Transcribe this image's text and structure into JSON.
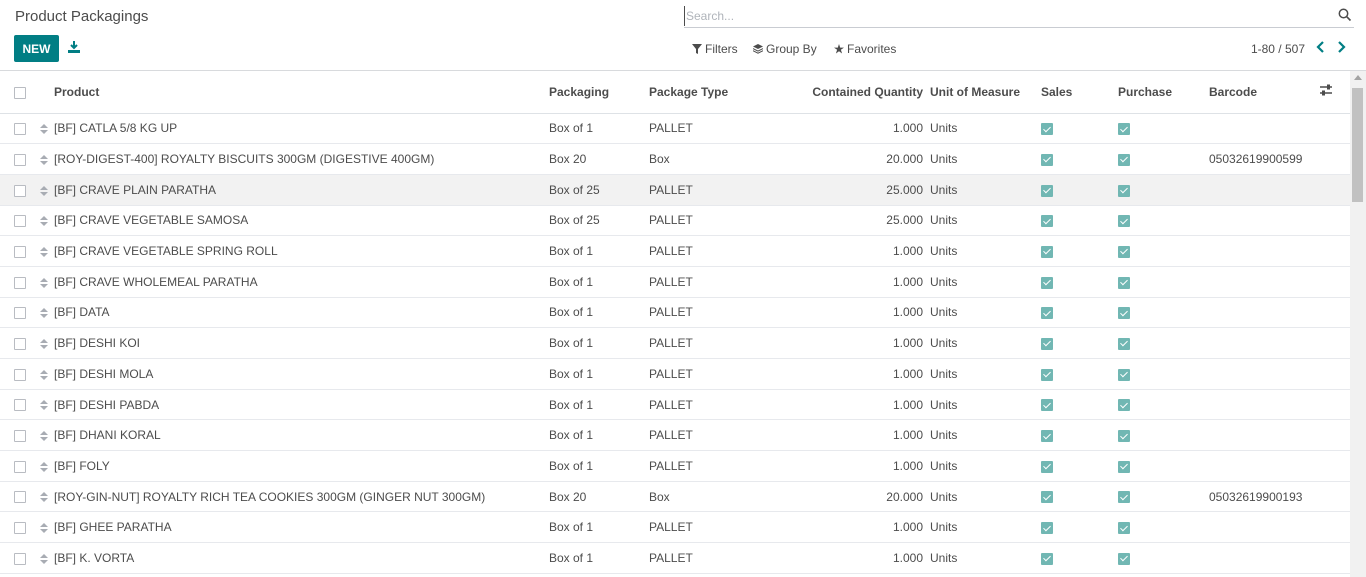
{
  "page": {
    "title": "Product Packagings",
    "new_label": "NEW",
    "search_placeholder": "Search...",
    "filters_label": "Filters",
    "groupby_label": "Group By",
    "favorites_label": "Favorites",
    "pager_text": "1-80 / 507"
  },
  "table": {
    "headers": {
      "product": "Product",
      "packaging": "Packaging",
      "package_type": "Package Type",
      "contained_quantity": "Contained Quantity",
      "uom": "Unit of Measure",
      "sales": "Sales",
      "purchase": "Purchase",
      "barcode": "Barcode"
    },
    "rows": [
      {
        "product": "[BF] CATLA 5/8 KG UP",
        "packaging": "Box of 1",
        "package_type": "PALLET",
        "qty": "1.000",
        "uom": "Units",
        "sales": true,
        "purchase": true,
        "barcode": ""
      },
      {
        "product": "[ROY-DIGEST-400] ROYALTY BISCUITS 300GM (DIGESTIVE 400GM)",
        "packaging": "Box 20",
        "package_type": "Box",
        "qty": "20.000",
        "uom": "Units",
        "sales": true,
        "purchase": true,
        "barcode": "05032619900599"
      },
      {
        "product": "[BF] CRAVE PLAIN PARATHA",
        "packaging": "Box of 25",
        "package_type": "PALLET",
        "qty": "25.000",
        "uom": "Units",
        "sales": true,
        "purchase": true,
        "barcode": ""
      },
      {
        "product": "[BF] CRAVE VEGETABLE SAMOSA",
        "packaging": "Box of 25",
        "package_type": "PALLET",
        "qty": "25.000",
        "uom": "Units",
        "sales": true,
        "purchase": true,
        "barcode": ""
      },
      {
        "product": "[BF] CRAVE VEGETABLE SPRING ROLL",
        "packaging": "Box of 1",
        "package_type": "PALLET",
        "qty": "1.000",
        "uom": "Units",
        "sales": true,
        "purchase": true,
        "barcode": ""
      },
      {
        "product": "[BF] CRAVE WHOLEMEAL PARATHA",
        "packaging": "Box of 1",
        "package_type": "PALLET",
        "qty": "1.000",
        "uom": "Units",
        "sales": true,
        "purchase": true,
        "barcode": ""
      },
      {
        "product": "[BF] DATA",
        "packaging": "Box of 1",
        "package_type": "PALLET",
        "qty": "1.000",
        "uom": "Units",
        "sales": true,
        "purchase": true,
        "barcode": ""
      },
      {
        "product": "[BF] DESHI KOI",
        "packaging": "Box of 1",
        "package_type": "PALLET",
        "qty": "1.000",
        "uom": "Units",
        "sales": true,
        "purchase": true,
        "barcode": ""
      },
      {
        "product": "[BF] DESHI MOLA",
        "packaging": "Box of 1",
        "package_type": "PALLET",
        "qty": "1.000",
        "uom": "Units",
        "sales": true,
        "purchase": true,
        "barcode": ""
      },
      {
        "product": "[BF] DESHI PABDA",
        "packaging": "Box of 1",
        "package_type": "PALLET",
        "qty": "1.000",
        "uom": "Units",
        "sales": true,
        "purchase": true,
        "barcode": ""
      },
      {
        "product": "[BF] DHANI KORAL",
        "packaging": "Box of 1",
        "package_type": "PALLET",
        "qty": "1.000",
        "uom": "Units",
        "sales": true,
        "purchase": true,
        "barcode": ""
      },
      {
        "product": "[BF] FOLY",
        "packaging": "Box of 1",
        "package_type": "PALLET",
        "qty": "1.000",
        "uom": "Units",
        "sales": true,
        "purchase": true,
        "barcode": ""
      },
      {
        "product": "[ROY-GIN-NUT] ROYALTY RICH TEA COOKIES 300GM (GINGER NUT 300GM)",
        "packaging": "Box 20",
        "package_type": "Box",
        "qty": "20.000",
        "uom": "Units",
        "sales": true,
        "purchase": true,
        "barcode": "05032619900193"
      },
      {
        "product": "[BF] GHEE PARATHA",
        "packaging": "Box of 1",
        "package_type": "PALLET",
        "qty": "1.000",
        "uom": "Units",
        "sales": true,
        "purchase": true,
        "barcode": ""
      },
      {
        "product": "[BF] K. VORTA",
        "packaging": "Box of 1",
        "package_type": "PALLET",
        "qty": "1.000",
        "uom": "Units",
        "sales": true,
        "purchase": true,
        "barcode": ""
      },
      {
        "product": "",
        "packaging": "",
        "package_type": "",
        "qty": "",
        "uom": "",
        "sales": false,
        "purchase": false,
        "barcode": ""
      }
    ]
  },
  "icons": {
    "download": "download-icon",
    "search": "search-icon",
    "filter": "filter-icon",
    "groupby": "layers-icon",
    "favorites": "star-icon",
    "prev": "chevron-left-icon",
    "next": "chevron-right-icon",
    "optional_columns": "sliders-icon",
    "row_handle": "drag-handle-icon"
  },
  "colors": {
    "primary": "#017e84",
    "checkbox_checked": "#71b7b3",
    "row_hover": "#f2f2f2"
  }
}
